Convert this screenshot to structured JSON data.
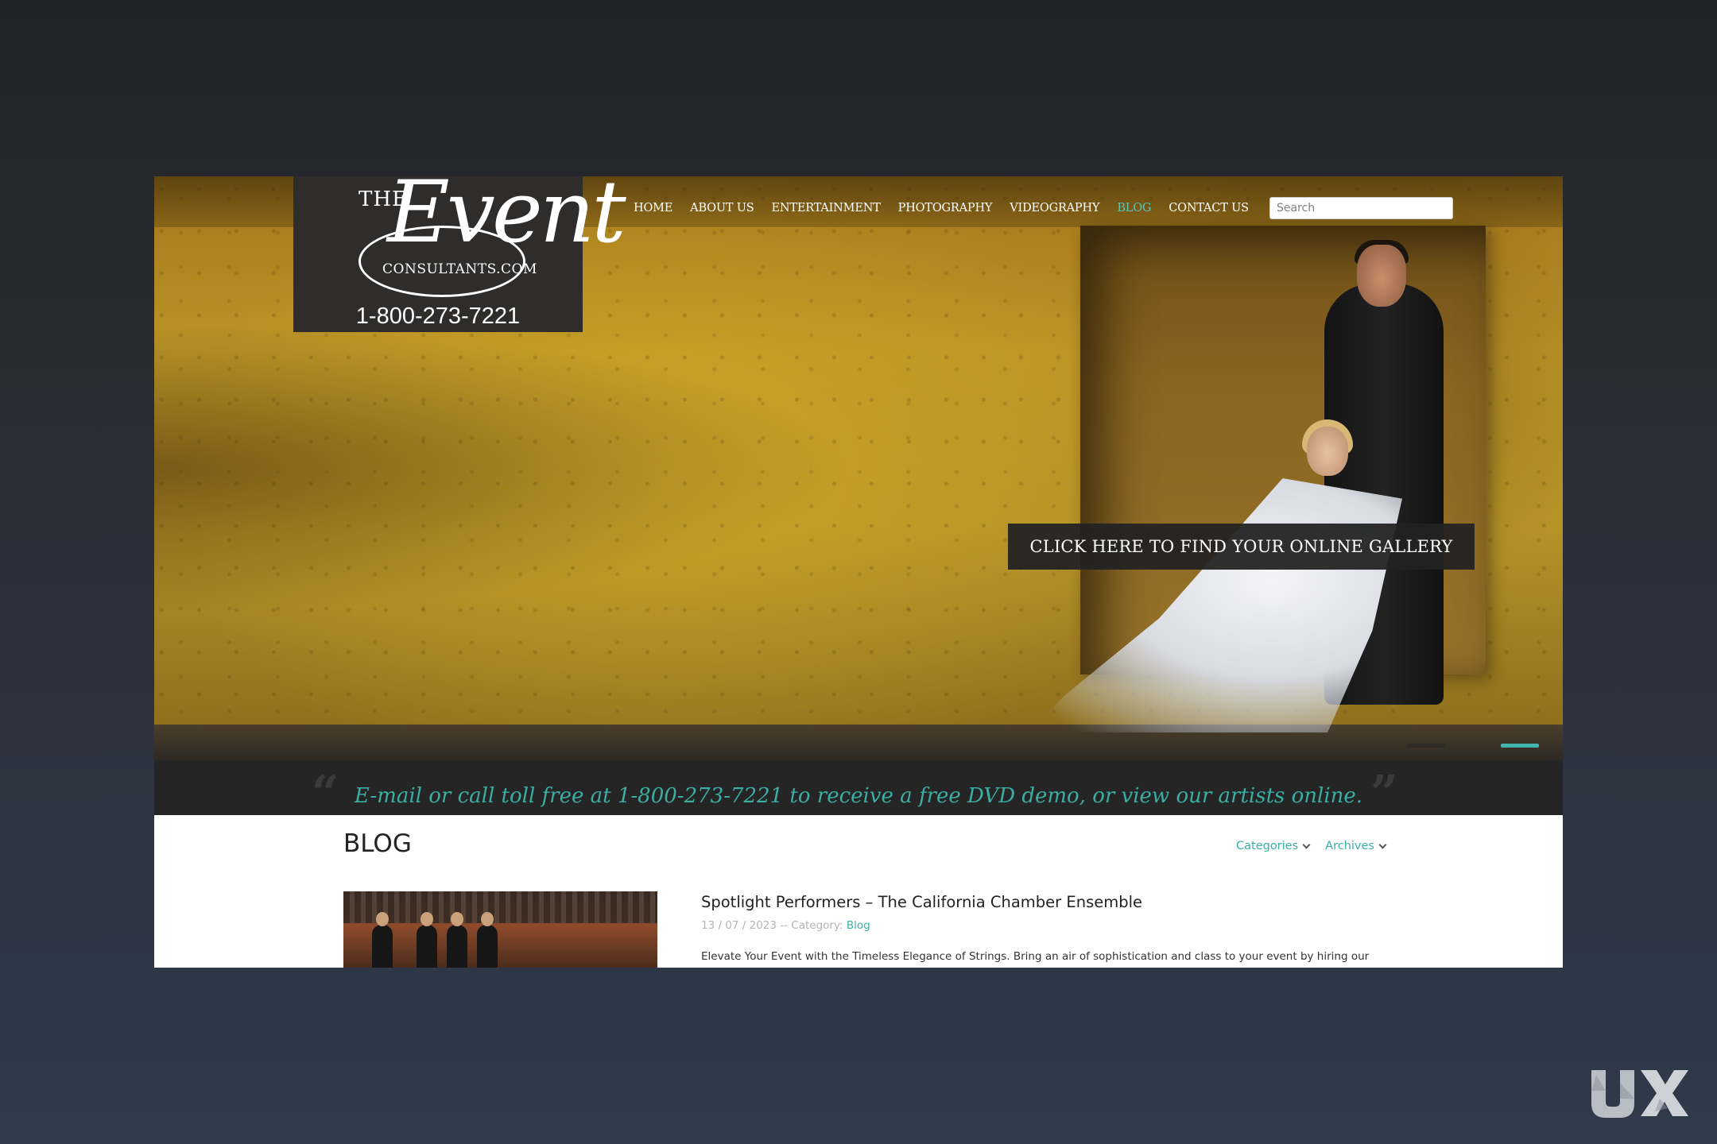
{
  "logo": {
    "the": "THE",
    "event": "Event",
    "consultants": "CONSULTANTS.COM",
    "phone": "1-800-273-7221"
  },
  "nav": {
    "items": [
      {
        "label": "HOME"
      },
      {
        "label": "ABOUT US"
      },
      {
        "label": "ENTERTAINMENT"
      },
      {
        "label": "PHOTOGRAPHY"
      },
      {
        "label": "VIDEOGRAPHY"
      },
      {
        "label": "BLOG",
        "active": true
      },
      {
        "label": "CONTACT US"
      }
    ],
    "search_placeholder": "Search",
    "active_color": "#58c6b8"
  },
  "hero": {
    "cta_label": "CLICK HERE TO FIND YOUR ONLINE GALLERY",
    "slide_active": 2,
    "slide_count": 2
  },
  "quote": {
    "text": "E-mail or call toll free at 1-800-273-7221 to receive a free DVD demo, or view our artists online.",
    "open_mark": "“",
    "close_mark": "”"
  },
  "blog": {
    "title": "BLOG",
    "filters": [
      {
        "label": "Categories"
      },
      {
        "label": "Archives"
      }
    ],
    "posts": [
      {
        "title": "Spotlight Performers – The California Chamber Ensemble",
        "date": "13 / 07 / 2023",
        "meta_sep": " -- Category: ",
        "category": "Blog",
        "excerpt": "Elevate Your Event with the Timeless Elegance of Strings. Bring an air of sophistication and class to your event by hiring our"
      }
    ]
  },
  "colors": {
    "accent": "#3aaea3",
    "page_bg": "#303a4b",
    "bar_bg": "#252525"
  },
  "watermark": {
    "text": "UX"
  }
}
